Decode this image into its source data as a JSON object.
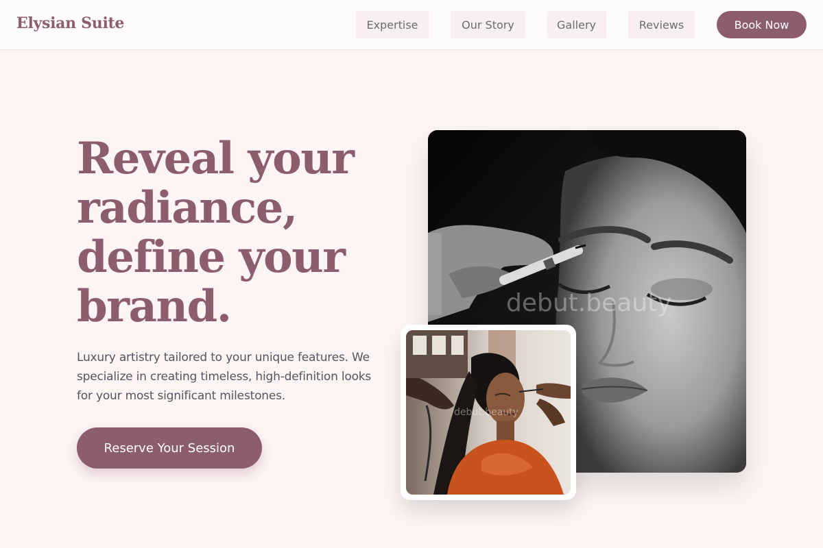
{
  "header": {
    "brand": "Elysian Suite",
    "nav": [
      {
        "label": "Expertise"
      },
      {
        "label": "Our Story"
      },
      {
        "label": "Gallery"
      },
      {
        "label": "Reviews"
      }
    ],
    "book_label": "Book Now"
  },
  "hero": {
    "title_lines": [
      "Reveal your",
      "radiance,",
      "define your",
      "brand."
    ],
    "description_lines": [
      "Luxury artistry tailored to your unique features. We",
      "specialize in creating timeless, high-definition looks",
      "for your most significant milestones."
    ],
    "cta_label": "Reserve Your Session"
  },
  "images": {
    "main_watermark": "debut.beauty",
    "inset_watermark": "debut.beauty"
  },
  "colors": {
    "accent": "#8b5d6e",
    "background": "#fdf4f4",
    "header_bg": "#fefbfb",
    "nav_bg": "#f8f0f0"
  }
}
